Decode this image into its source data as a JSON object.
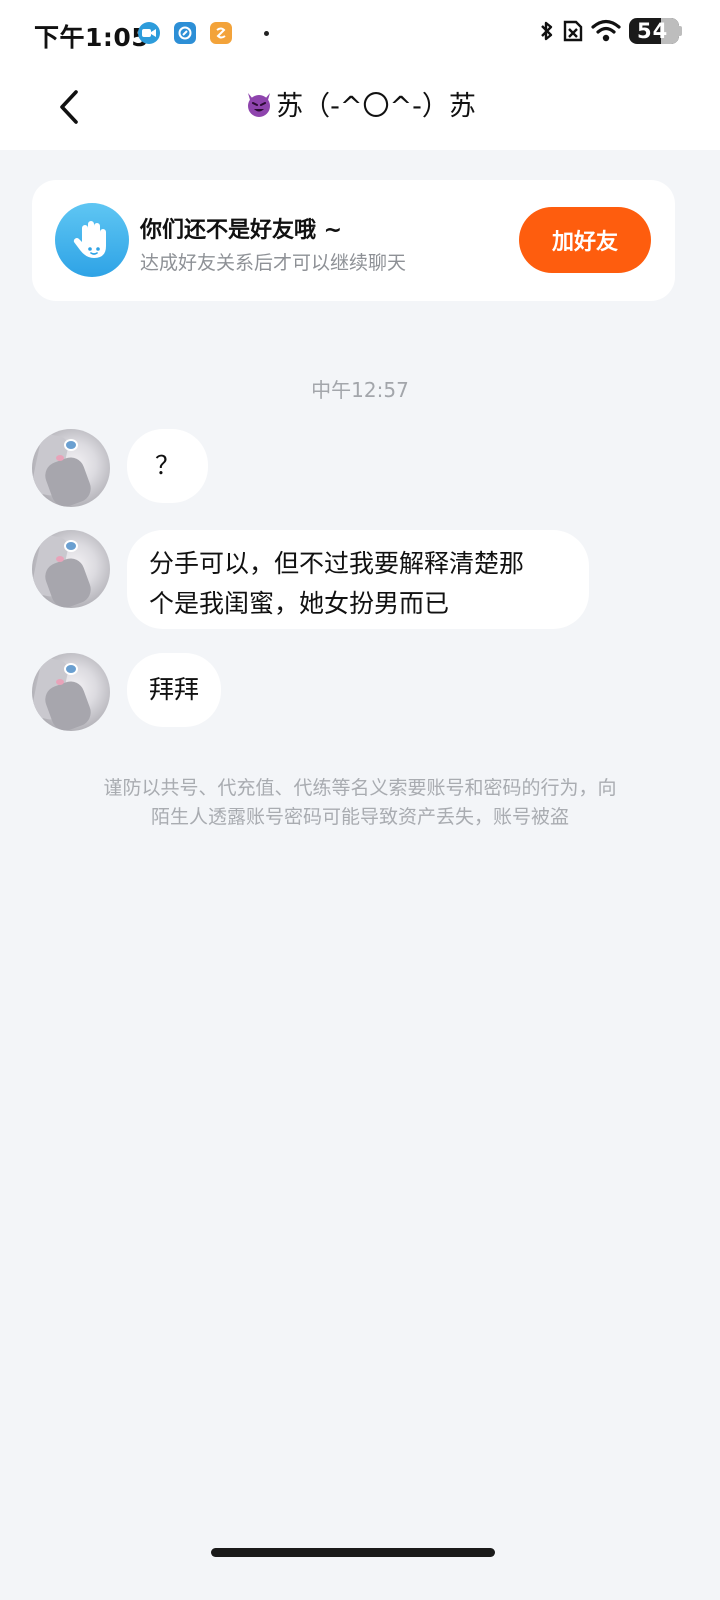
{
  "status_bar": {
    "time": "下午1:05",
    "battery": "54",
    "notification_icons": [
      "video-call-icon",
      "shield-app-icon",
      "orange-app-icon"
    ]
  },
  "header": {
    "back_icon": "chevron-left-icon",
    "title": "苏（-^〇^-）苏",
    "title_emoji": "smiling-devil-emoji"
  },
  "friend_banner": {
    "icon": "waving-hand-icon",
    "title": "你们还不是好友哦 ~",
    "subtitle": "达成好友关系后才可以继续聊天",
    "button_label": "加好友",
    "button_color": "#fe5d0e"
  },
  "chat": {
    "timestamp": "中午12:57",
    "messages": [
      {
        "text": "？"
      },
      {
        "text_line1": "分手可以，但不过我要解释清楚那",
        "text_line2": "个是我闺蜜，她女扮男而已"
      },
      {
        "text": "拜拜"
      }
    ]
  },
  "notice": {
    "line1": "谨防以共号、代充值、代练等名义索要账号和密码的行为，向",
    "line2": "陌生人透露账号密码可能导致资产丢失，账号被盗"
  }
}
